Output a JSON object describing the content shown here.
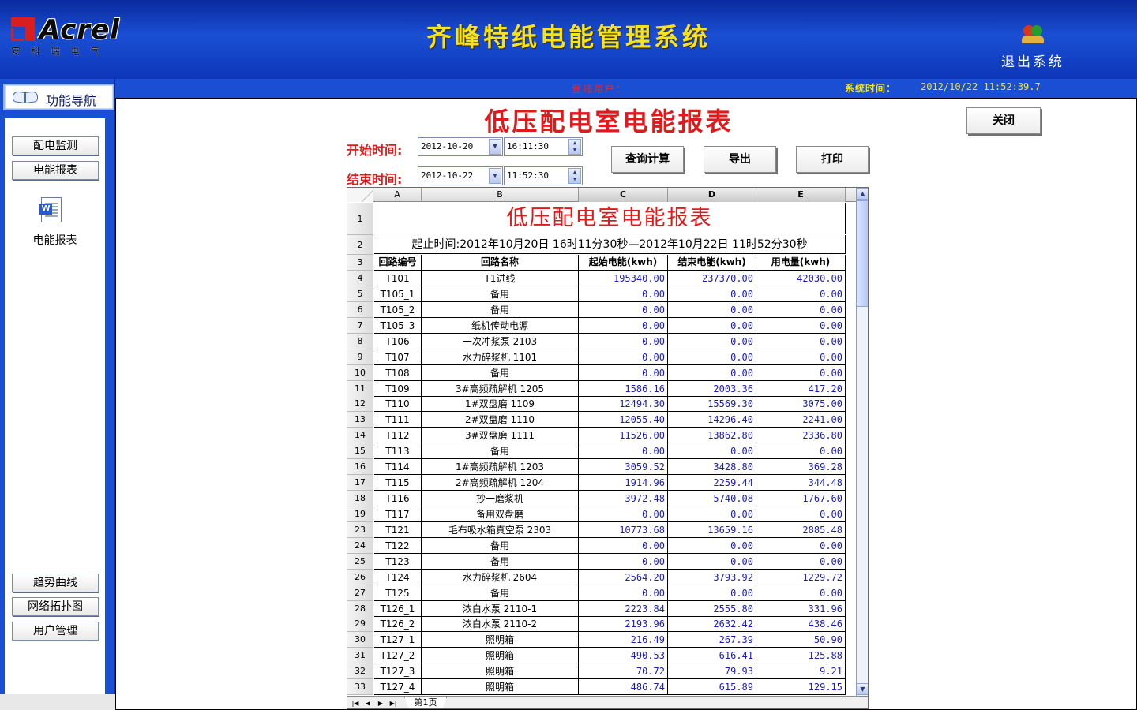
{
  "header": {
    "logo_text": "Acrel",
    "logo_sub": "安科瑞电气",
    "title": "齐峰特纸电能管理系统",
    "exit_label": "退出系统"
  },
  "infobar": {
    "login_label": "登陆用户：",
    "time_label": "系统时间：",
    "time_value": "2012/10/22    11:52:39.7"
  },
  "sidebar": {
    "nav_title": "功能导航",
    "top_items": [
      "配电监测",
      "电能报表"
    ],
    "report_icon_label": "电能报表",
    "bottom_items": [
      "趋势曲线",
      "网络拓扑图",
      "用户管理"
    ]
  },
  "main": {
    "title": "低压配电室电能报表",
    "close_label": "关闭",
    "start_label": "开始时间:",
    "end_label": "结束时间:",
    "start_date": "2012-10-20",
    "start_time": "16:11:30",
    "end_date": "2012-10-22",
    "end_time": "11:52:30",
    "query_label": "查询计算",
    "export_label": "导出",
    "print_label": "打印"
  },
  "sheet": {
    "columns": [
      "A",
      "B",
      "C",
      "D",
      "E"
    ],
    "title": "低压配电室电能报表",
    "range_text": "起止时间:2012年10月20日  16时11分30秒—2012年10月22日  11时52分30秒",
    "headers": [
      "回路编号",
      "回路名称",
      "起始电能(kwh)",
      "结束电能(kwh)",
      "用电量(kwh)"
    ],
    "rows": [
      {
        "n": "4",
        "id": "T101",
        "name": "T1进线",
        "start": "195340.00",
        "end": "237370.00",
        "use": "42030.00"
      },
      {
        "n": "5",
        "id": "T105_1",
        "name": "备用",
        "start": "0.00",
        "end": "0.00",
        "use": "0.00"
      },
      {
        "n": "6",
        "id": "T105_2",
        "name": "备用",
        "start": "0.00",
        "end": "0.00",
        "use": "0.00"
      },
      {
        "n": "7",
        "id": "T105_3",
        "name": "纸机传动电源",
        "start": "0.00",
        "end": "0.00",
        "use": "0.00"
      },
      {
        "n": "8",
        "id": "T106",
        "name": "一次冲浆泵  2103",
        "start": "0.00",
        "end": "0.00",
        "use": "0.00"
      },
      {
        "n": "9",
        "id": "T107",
        "name": "水力碎浆机  1101",
        "start": "0.00",
        "end": "0.00",
        "use": "0.00"
      },
      {
        "n": "10",
        "id": "T108",
        "name": "备用",
        "start": "0.00",
        "end": "0.00",
        "use": "0.00"
      },
      {
        "n": "11",
        "id": "T109",
        "name": "3#高频疏解机  1205",
        "start": "1586.16",
        "end": "2003.36",
        "use": "417.20"
      },
      {
        "n": "12",
        "id": "T110",
        "name": "1#双盘磨  1109",
        "start": "12494.30",
        "end": "15569.30",
        "use": "3075.00"
      },
      {
        "n": "13",
        "id": "T111",
        "name": "2#双盘磨  1110",
        "start": "12055.40",
        "end": "14296.40",
        "use": "2241.00"
      },
      {
        "n": "14",
        "id": "T112",
        "name": "3#双盘磨  1111",
        "start": "11526.00",
        "end": "13862.80",
        "use": "2336.80"
      },
      {
        "n": "15",
        "id": "T113",
        "name": "备用",
        "start": "0.00",
        "end": "0.00",
        "use": "0.00"
      },
      {
        "n": "16",
        "id": "T114",
        "name": "1#高频疏解机  1203",
        "start": "3059.52",
        "end": "3428.80",
        "use": "369.28"
      },
      {
        "n": "17",
        "id": "T115",
        "name": "2#高频疏解机  1204",
        "start": "1914.96",
        "end": "2259.44",
        "use": "344.48"
      },
      {
        "n": "18",
        "id": "T116",
        "name": "抄一磨浆机",
        "start": "3972.48",
        "end": "5740.08",
        "use": "1767.60"
      },
      {
        "n": "19",
        "id": "T117",
        "name": "备用双盘磨",
        "start": "0.00",
        "end": "0.00",
        "use": "0.00"
      },
      {
        "n": "23",
        "id": "T121",
        "name": "毛布吸水箱真空泵  2303",
        "start": "10773.68",
        "end": "13659.16",
        "use": "2885.48"
      },
      {
        "n": "24",
        "id": "T122",
        "name": "备用",
        "start": "0.00",
        "end": "0.00",
        "use": "0.00"
      },
      {
        "n": "25",
        "id": "T123",
        "name": "备用",
        "start": "0.00",
        "end": "0.00",
        "use": "0.00"
      },
      {
        "n": "26",
        "id": "T124",
        "name": "水力碎浆机  2604",
        "start": "2564.20",
        "end": "3793.92",
        "use": "1229.72"
      },
      {
        "n": "27",
        "id": "T125",
        "name": "备用",
        "start": "0.00",
        "end": "0.00",
        "use": "0.00"
      },
      {
        "n": "28",
        "id": "T126_1",
        "name": "浓白水泵  2110-1",
        "start": "2223.84",
        "end": "2555.80",
        "use": "331.96"
      },
      {
        "n": "29",
        "id": "T126_2",
        "name": "浓白水泵  2110-2",
        "start": "2193.96",
        "end": "2632.42",
        "use": "438.46"
      },
      {
        "n": "30",
        "id": "T127_1",
        "name": "照明箱",
        "start": "216.49",
        "end": "267.39",
        "use": "50.90"
      },
      {
        "n": "31",
        "id": "T127_2",
        "name": "照明箱",
        "start": "490.53",
        "end": "616.41",
        "use": "125.88"
      },
      {
        "n": "32",
        "id": "T127_3",
        "name": "照明箱",
        "start": "70.72",
        "end": "79.93",
        "use": "9.21"
      },
      {
        "n": "33",
        "id": "T127_4",
        "name": "照明箱",
        "start": "486.74",
        "end": "615.89",
        "use": "129.15"
      }
    ],
    "tab_label": "第1页"
  }
}
